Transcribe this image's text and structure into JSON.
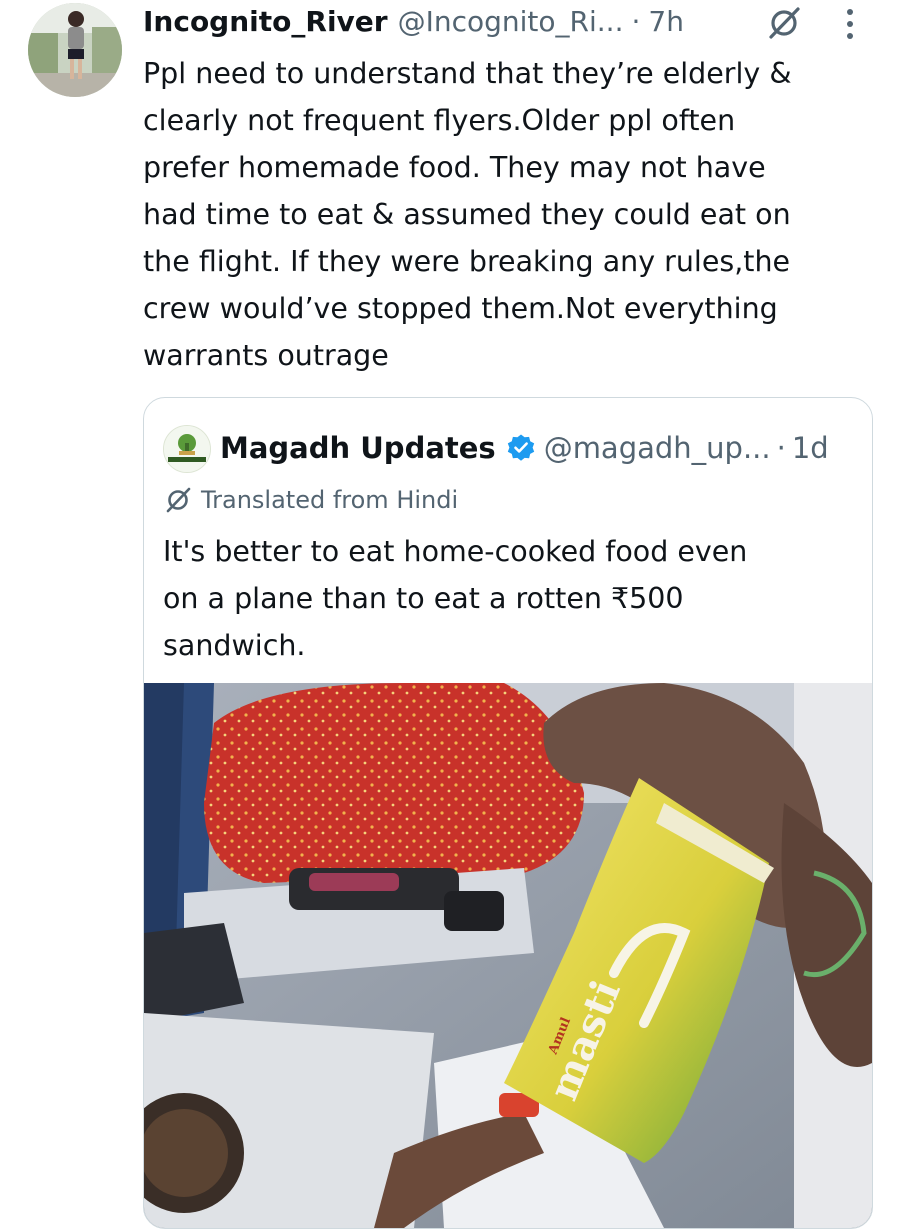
{
  "tweet": {
    "author_name": "Incognito_River",
    "author_handle": "@Incognito_Ri...",
    "separator": "·",
    "time": "7h",
    "lines": [
      "Ppl need to understand that they’re elderly &",
      "clearly not frequent flyers.Older ppl often",
      "prefer homemade food. They may not have",
      "had time to eat & assumed they could eat on",
      "the flight. If they were breaking any rules,the",
      "crew would’ve stopped them.Not everything",
      "warrants outrage"
    ],
    "icons": {
      "grok": "grok-icon",
      "more": "more-icon"
    }
  },
  "quote": {
    "author_name": "Magadh Updates",
    "author_handle": "@magadh_up...",
    "separator": "·",
    "time": "1d",
    "verified": true,
    "translated_label": "Translated from Hindi",
    "lines": [
      "It's better to eat home-cooked food even",
      "on a plane than to eat a rotten ₹500",
      "sandwich."
    ],
    "avatar_text": "MAGADH UPDATES",
    "media": {
      "description_icons": "photo",
      "brand_small": "Amul",
      "brand_large": "masti"
    }
  },
  "colors": {
    "text": "#0f1419",
    "secondary": "#536471",
    "border": "#cfd9de",
    "verified": "#1d9bf0"
  }
}
